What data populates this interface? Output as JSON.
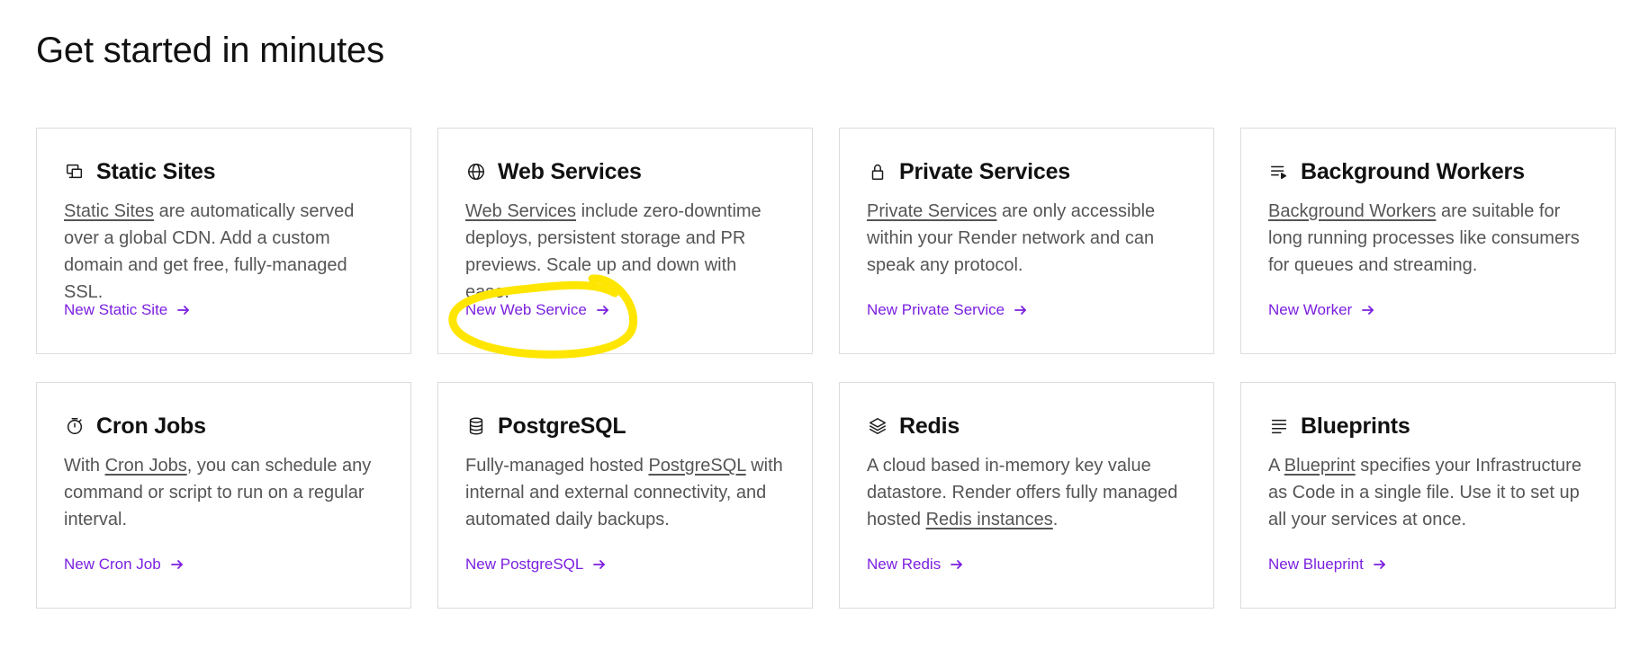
{
  "page": {
    "title": "Get started in minutes"
  },
  "colors": {
    "accent": "#7b1fe0",
    "highlight": "#ffe600",
    "border": "#dcdcdc",
    "body_text": "#555555"
  },
  "cards": [
    {
      "icon": "static-site-icon",
      "title": "Static Sites",
      "desc": [
        {
          "text": "Static Sites",
          "link": true
        },
        {
          "text": " are automatically served over a global CDN. Add a custom domain and get free, fully-managed SSL.",
          "link": false
        }
      ],
      "action": "New Static Site"
    },
    {
      "icon": "globe-icon",
      "title": "Web Services",
      "desc": [
        {
          "text": "Web Services",
          "link": true
        },
        {
          "text": " include zero-downtime deploys, persistent storage and PR previews. Scale up and down with ease.",
          "link": false
        }
      ],
      "action": "New Web Service"
    },
    {
      "icon": "lock-icon",
      "title": "Private Services",
      "desc": [
        {
          "text": "Private Services",
          "link": true
        },
        {
          "text": " are only accessible within your Render network and can speak any protocol.",
          "link": false
        }
      ],
      "action": "New Private Service"
    },
    {
      "icon": "queue-icon",
      "title": "Background Workers",
      "desc": [
        {
          "text": "Background Workers",
          "link": true
        },
        {
          "text": " are suitable for long running processes like consumers for queues and streaming.",
          "link": false
        }
      ],
      "action": "New Worker"
    },
    {
      "icon": "stopwatch-icon",
      "title": "Cron Jobs",
      "desc": [
        {
          "text": "With ",
          "link": false
        },
        {
          "text": "Cron Jobs",
          "link": true
        },
        {
          "text": ", you can schedule any command or script to run on a regular interval.",
          "link": false
        }
      ],
      "action": "New Cron Job"
    },
    {
      "icon": "database-icon",
      "title": "PostgreSQL",
      "desc": [
        {
          "text": "Fully-managed hosted ",
          "link": false
        },
        {
          "text": "PostgreSQL",
          "link": true
        },
        {
          "text": " with internal and external connectivity, and automated daily backups.",
          "link": false
        }
      ],
      "action": "New PostgreSQL"
    },
    {
      "icon": "layers-icon",
      "title": "Redis",
      "desc": [
        {
          "text": "A cloud based in-memory key value datastore. Render offers fully managed hosted ",
          "link": false
        },
        {
          "text": "Redis instances",
          "link": true
        },
        {
          "text": ".",
          "link": false
        }
      ],
      "action": "New Redis"
    },
    {
      "icon": "document-lines-icon",
      "title": "Blueprints",
      "desc": [
        {
          "text": "A ",
          "link": false
        },
        {
          "text": "Blueprint",
          "link": true
        },
        {
          "text": " specifies your Infrastructure as Code in a single file. Use it to set up all your services at once.",
          "link": false
        }
      ],
      "action": "New Blueprint"
    }
  ]
}
